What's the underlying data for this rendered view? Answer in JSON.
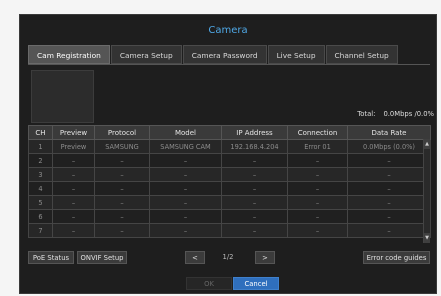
{
  "window": {
    "title": "Camera"
  },
  "tabs": [
    {
      "label": "Cam Registration",
      "active": true
    },
    {
      "label": "Camera Setup",
      "active": false
    },
    {
      "label": "Camera Password",
      "active": false
    },
    {
      "label": "Live Setup",
      "active": false
    },
    {
      "label": "Channel Setup",
      "active": false
    }
  ],
  "total": {
    "label": "Total:",
    "value": "0.0Mbps /0.0%"
  },
  "table": {
    "headers": [
      "CH",
      "Preview",
      "Protocol",
      "Model",
      "IP Address",
      "Connection",
      "Data Rate"
    ],
    "rows": [
      [
        "1",
        "Preview",
        "SAMSUNG",
        "SAMSUNG CAM",
        "192.168.4.204",
        "Error 01",
        "0.0Mbps (0.0%)"
      ],
      [
        "2",
        "–",
        "–",
        "–",
        "–",
        "–",
        "–"
      ],
      [
        "3",
        "–",
        "–",
        "–",
        "–",
        "–",
        "–"
      ],
      [
        "4",
        "–",
        "–",
        "–",
        "–",
        "–",
        "–"
      ],
      [
        "5",
        "–",
        "–",
        "–",
        "–",
        "–",
        "–"
      ],
      [
        "6",
        "–",
        "–",
        "–",
        "–",
        "–",
        "–"
      ],
      [
        "7",
        "–",
        "–",
        "–",
        "–",
        "–",
        "–"
      ]
    ]
  },
  "buttons": {
    "poe_status": "PoE Status",
    "onvif_setup": "ONVIF Setup",
    "prev": "<",
    "next": ">",
    "error_guides": "Error code guides",
    "ok": "OK",
    "cancel": "Cancel"
  },
  "pagination": {
    "text": "1/2"
  },
  "icons": {
    "scroll_up": "scroll-up-icon",
    "scroll_down": "scroll-down-icon"
  },
  "colors": {
    "title": "#4fa8e6",
    "cancel": "#2f6fbd"
  }
}
